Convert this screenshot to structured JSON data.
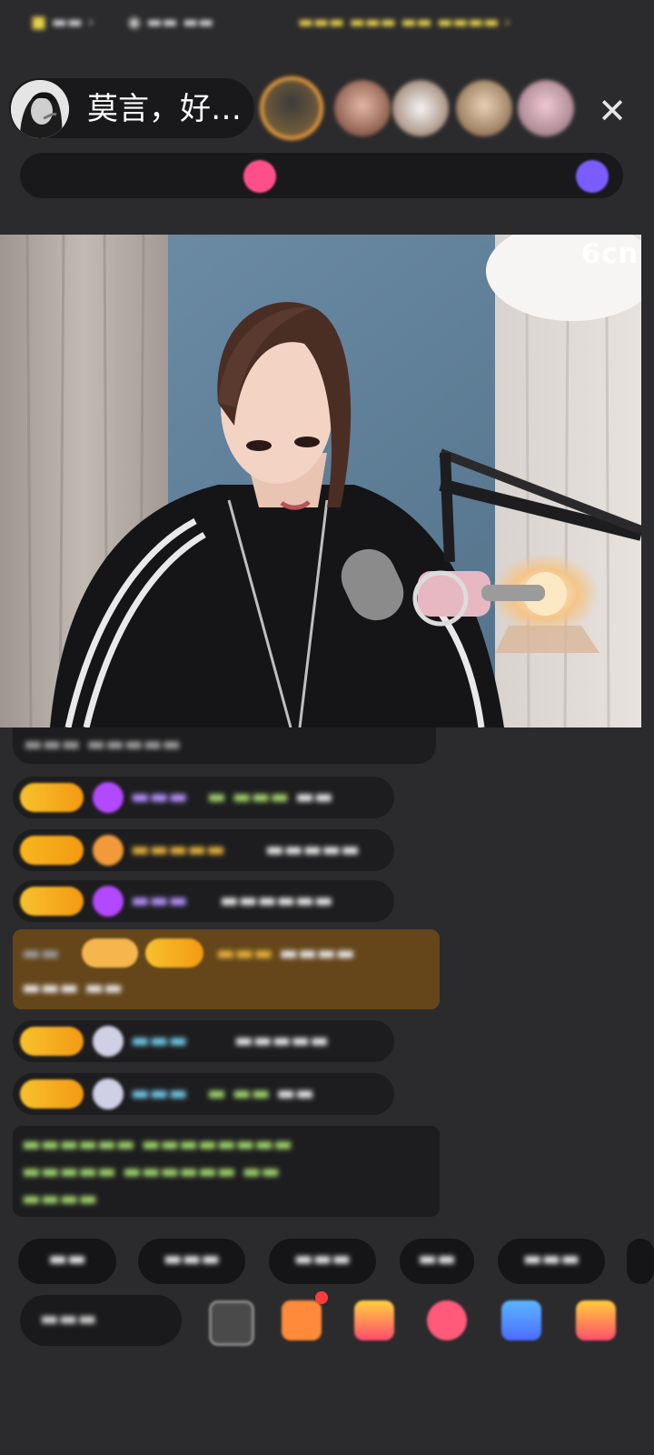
{
  "host": {
    "name": "莫言，好…"
  },
  "viewer_avatars_count_shown": 5,
  "watermark": "6cn",
  "colors": {
    "accent_gold": "#f2a23a",
    "badge_gold": "#f7c12c",
    "username_purple": "#b490ff",
    "text_green": "#9fd36a"
  },
  "icons": {
    "close": "close-icon",
    "gift": "gift-icon",
    "message": "message-icon"
  }
}
